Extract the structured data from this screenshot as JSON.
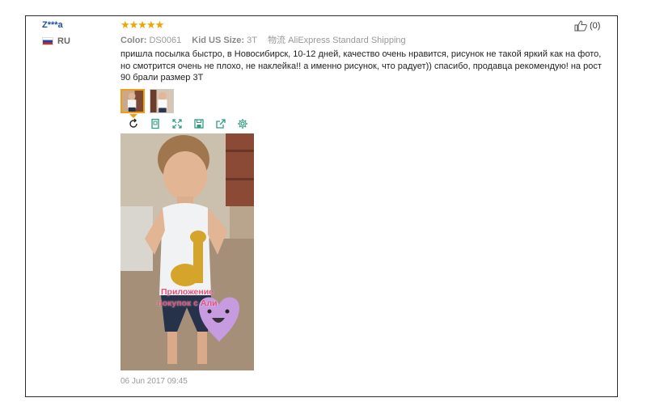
{
  "user": {
    "name": "Z***a",
    "country": "RU"
  },
  "rating": {
    "stars": "★★★★★"
  },
  "attributes": {
    "color_label": "Color:",
    "color_value": "DS0061",
    "size_label": "Kid US Size:",
    "size_value": "3T",
    "shipping_label": "物流",
    "shipping_value": "AliExpress Standard Shipping"
  },
  "review": {
    "text": "пришла посылка быстро, в Новосибирск, 10-12 дней, качество очень нравится, рисунок не такой яркий как на фото, но смотрится очень не плохо, не наклейка!! а именно рисунок, что радует)) спасибо, продавца рекомендую! на рост 90 брали размер 3Т",
    "date": "06 Jun 2017 09:45"
  },
  "helpful": {
    "count": "(0)"
  },
  "photo": {
    "watermark_line1": "Приложение",
    "watermark_line2": "покупок с Али"
  },
  "icons": [
    "flag-icon",
    "thumbs-up-icon",
    "rotate-icon",
    "fit-icon",
    "fullscreen-icon",
    "save-icon",
    "share-icon",
    "settings-icon"
  ]
}
